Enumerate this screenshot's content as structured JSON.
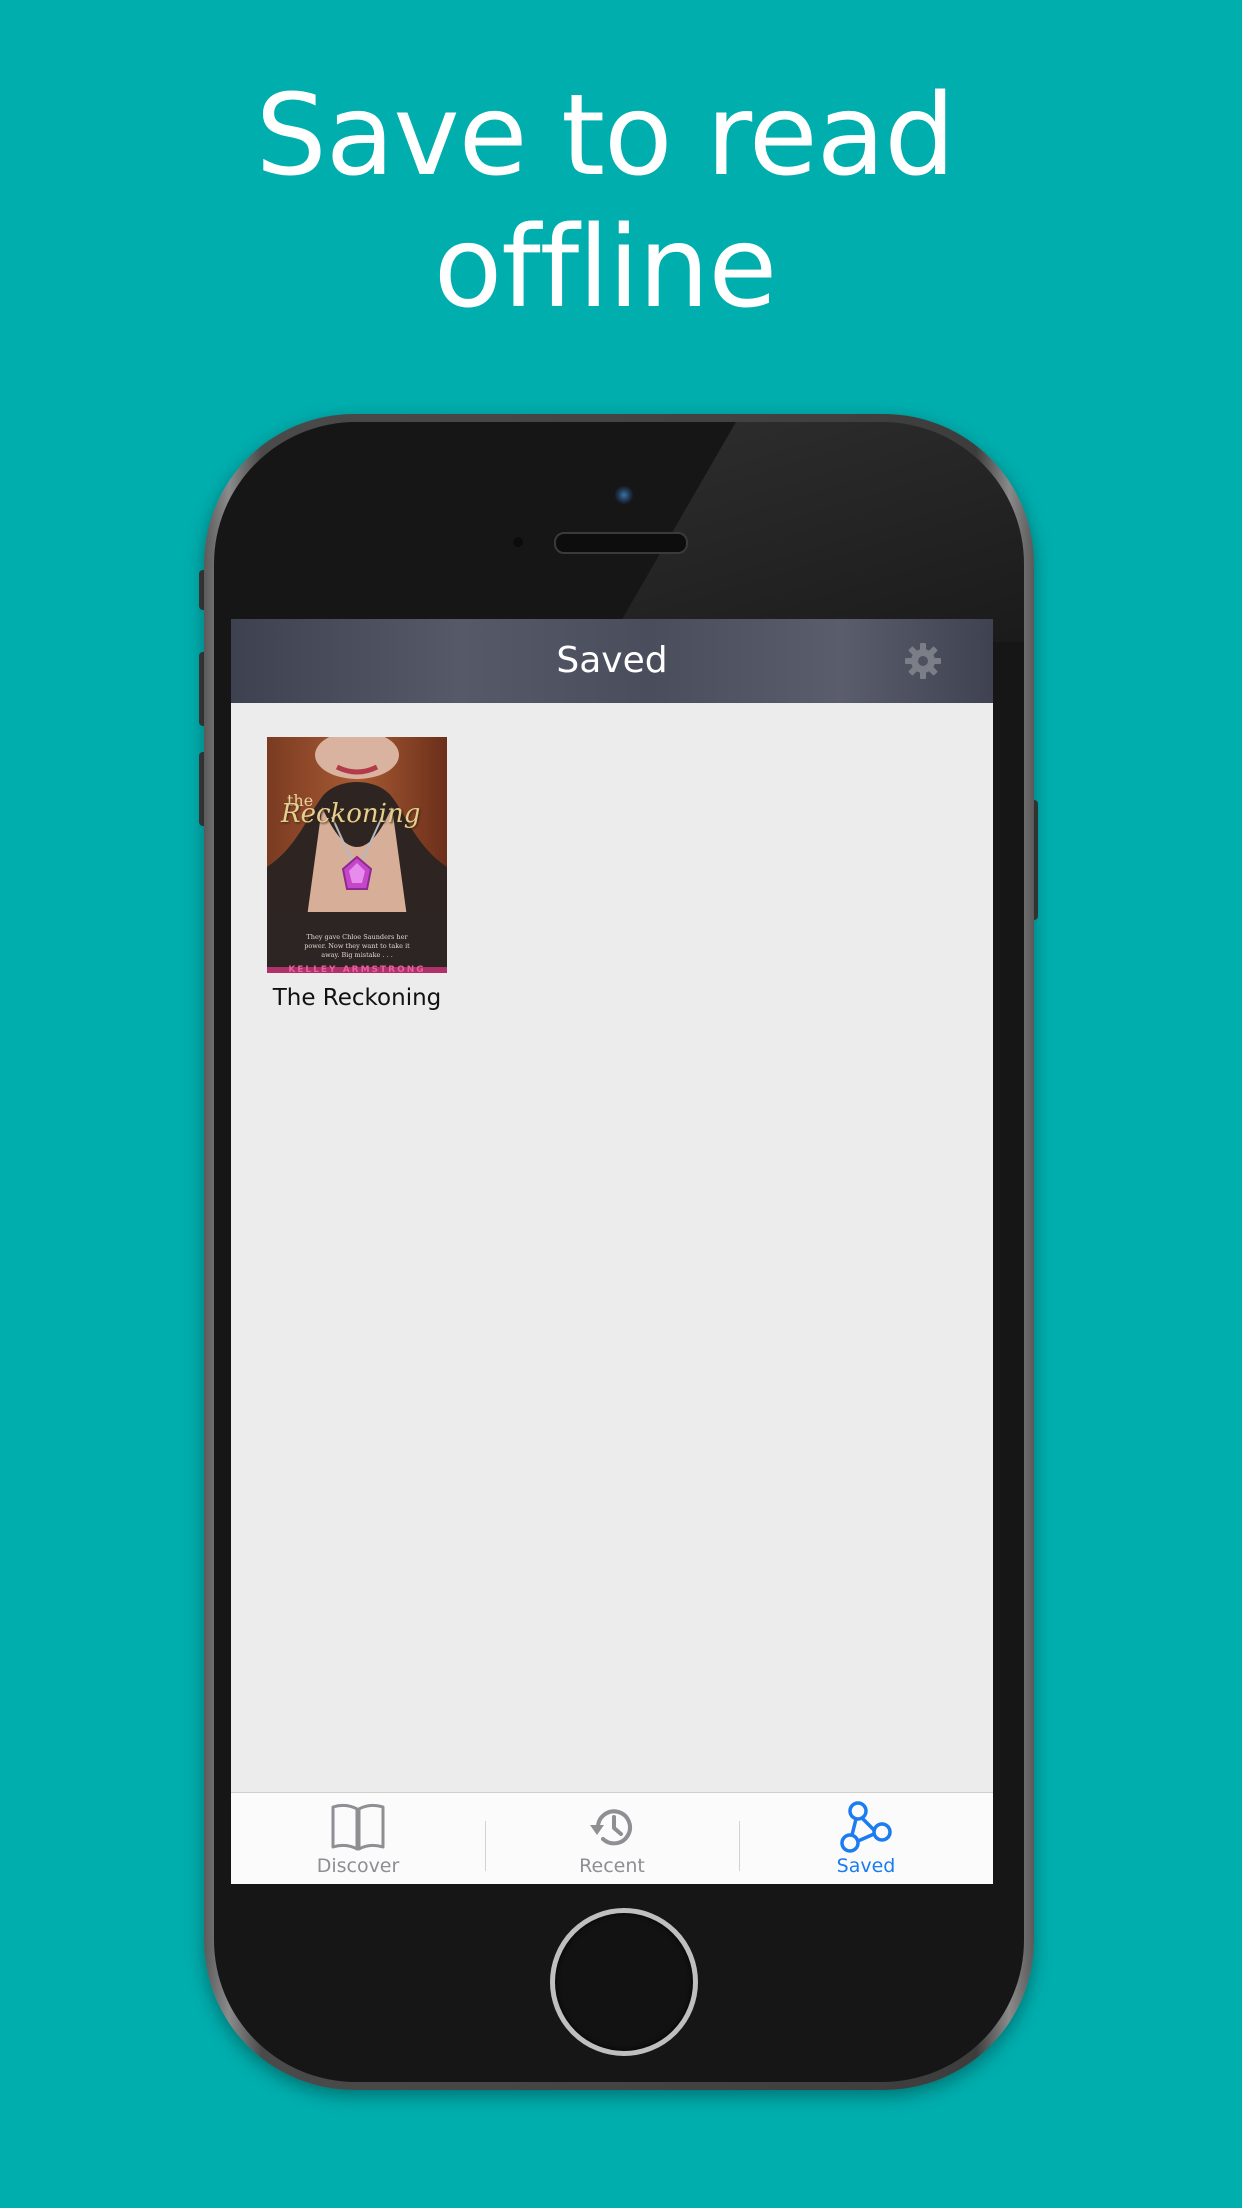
{
  "headline": {
    "line1": "Save to read",
    "line2": "offline"
  },
  "navbar": {
    "title": "Saved",
    "settings_icon": "gear-icon"
  },
  "saved_books": [
    {
      "title": "The Reckoning",
      "cover": {
        "title_line1": "the",
        "title_line2": "Reckoning",
        "blurb_line1": "They gave Chloe Saunders her",
        "blurb_line2": "power. Now they want to take it",
        "blurb_line3": "away. Big mistake . . .",
        "author": "KELLEY ARMSTRONG"
      }
    }
  ],
  "tabbar": {
    "tabs": [
      {
        "label": "Discover",
        "icon": "open-book-icon",
        "active": false
      },
      {
        "label": "Recent",
        "icon": "history-icon",
        "active": false
      },
      {
        "label": "Saved",
        "icon": "saved-nodes-icon",
        "active": true
      }
    ]
  },
  "colors": {
    "background": "#00aeae",
    "accent": "#1a7cf0",
    "inactive_tab": "#8e8e93",
    "screen_bg": "#ececec"
  }
}
